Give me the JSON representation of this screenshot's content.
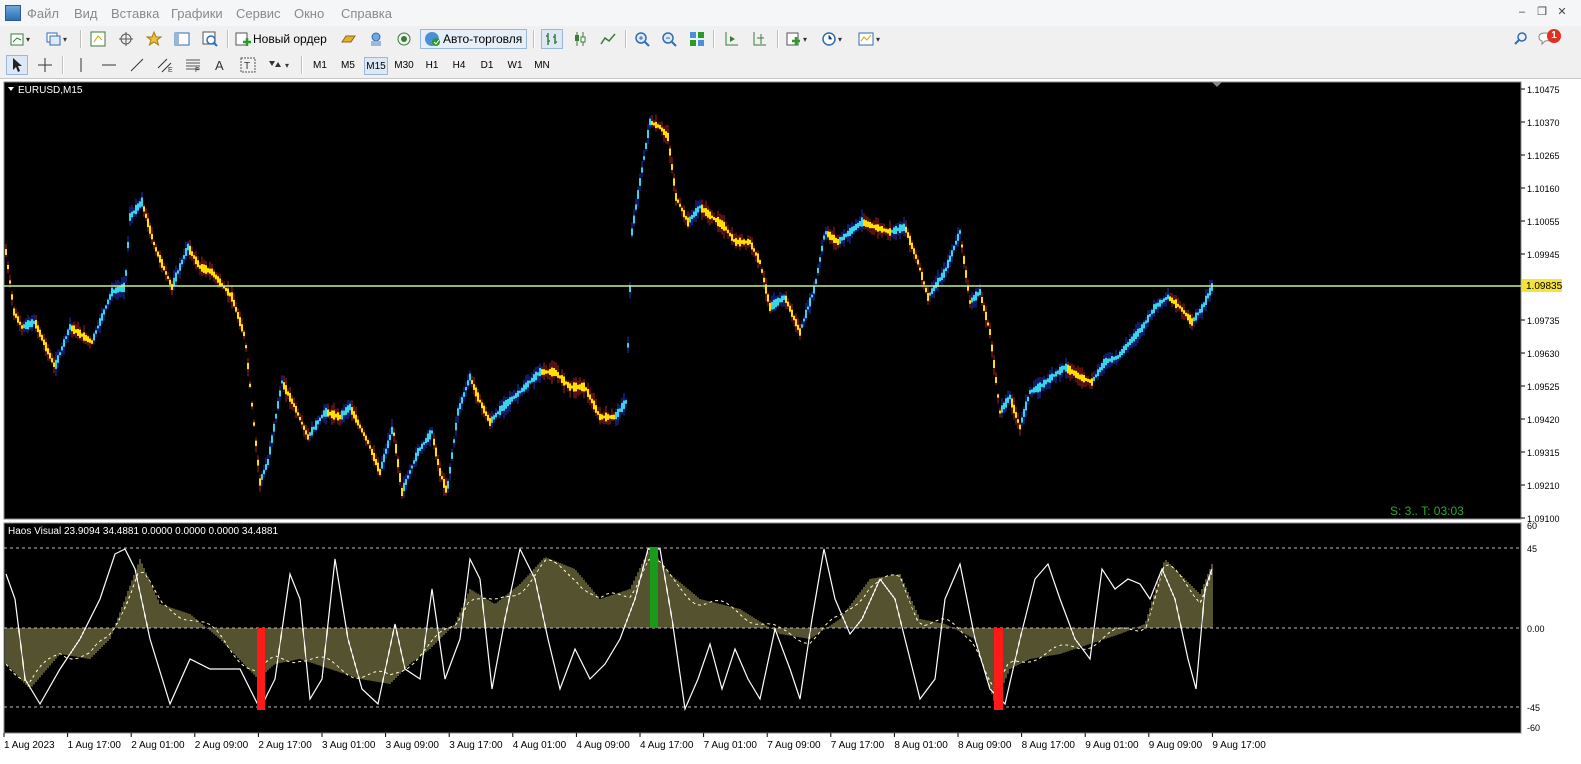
{
  "menu": [
    "Файл",
    "Вид",
    "Вставка",
    "Графики",
    "Сервис",
    "Окно",
    "Справка"
  ],
  "toolbar": {
    "new_order_label": "Новый ордер",
    "autotrading_label": "Авто-торговля",
    "notification_count": "1"
  },
  "timeframes": [
    "M1",
    "M5",
    "M15",
    "M30",
    "H1",
    "H4",
    "D1",
    "W1",
    "MN"
  ],
  "active_timeframe": "M15",
  "chart": {
    "symbol_label": "EURUSD,M15",
    "price_ticks": [
      "1.10475",
      "1.10370",
      "1.10265",
      "1.10160",
      "1.10055",
      "1.09945",
      "1.09835",
      "1.09735",
      "1.09630",
      "1.09525",
      "1.09420",
      "1.09315",
      "1.09210",
      "1.09100"
    ],
    "current_price": "1.09835",
    "status_text": "S: 3.. T: 03:03",
    "bar_up_color": "#36d6e8",
    "bar_down_color": "#ffe000",
    "price_line_color": "#c8f08a"
  },
  "indicator": {
    "label": "Haos Visual 23.9094 34.4881 0.0000 0.0000 0.0000 34.4881",
    "axis_ticks": [
      "60",
      "45",
      "0.00",
      "-45",
      "-60"
    ],
    "histogram_color": "#c8c070",
    "buy_color": "#1a9a1a",
    "sell_color": "#ff1a1a"
  },
  "time_axis": [
    "1 Aug 2023",
    "1 Aug 17:00",
    "2 Aug 01:00",
    "2 Aug 09:00",
    "2 Aug 17:00",
    "3 Aug 01:00",
    "3 Aug 09:00",
    "3 Aug 17:00",
    "4 Aug 01:00",
    "4 Aug 09:00",
    "4 Aug 17:00",
    "7 Aug 01:00",
    "7 Aug 09:00",
    "7 Aug 17:00",
    "8 Aug 01:00",
    "8 Aug 09:00",
    "8 Aug 17:00",
    "9 Aug 01:00",
    "9 Aug 09:00",
    "9 Aug 17:00"
  ]
}
